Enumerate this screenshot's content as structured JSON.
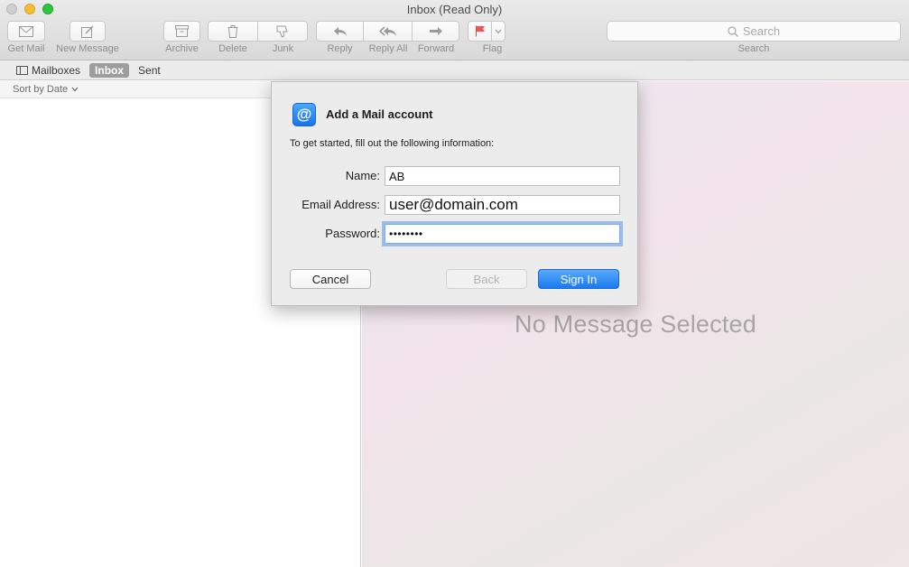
{
  "window": {
    "title": "Inbox (Read Only)"
  },
  "toolbar": {
    "get_mail": "Get Mail",
    "new_message": "New Message",
    "archive": "Archive",
    "delete": "Delete",
    "junk": "Junk",
    "reply": "Reply",
    "reply_all": "Reply All",
    "forward": "Forward",
    "flag": "Flag",
    "search_placeholder": "Search",
    "search_label": "Search"
  },
  "favorites": {
    "mailboxes": "Mailboxes",
    "inbox": "Inbox",
    "sent": "Sent"
  },
  "message_list": {
    "sort_label": "Sort by Date"
  },
  "viewer": {
    "empty_text": "No Message Selected"
  },
  "dialog": {
    "title": "Add a Mail account",
    "subtitle": "To get started, fill out the following information:",
    "name_label": "Name:",
    "name_value": "AB",
    "email_label": "Email Address:",
    "email_value": "user@domain.com",
    "password_label": "Password:",
    "password_value": "••••••••",
    "cancel": "Cancel",
    "back": "Back",
    "sign_in": "Sign In"
  },
  "colors": {
    "accent": "#1a79f0",
    "flag": "#f05454",
    "close_light": "#cfcfcf",
    "minimize_light": "#f5bd2f",
    "maximize_light": "#2ac840"
  },
  "icons": {
    "get_mail": "envelope-icon",
    "new_message": "compose-icon",
    "archive": "archive-box-icon",
    "delete": "trash-icon",
    "junk": "thumbs-down-icon",
    "reply": "reply-arrow-icon",
    "reply_all": "reply-all-arrow-icon",
    "forward": "forward-arrow-icon",
    "flag": "flag-icon",
    "search": "magnifier-icon",
    "account": "at-sign-icon"
  }
}
